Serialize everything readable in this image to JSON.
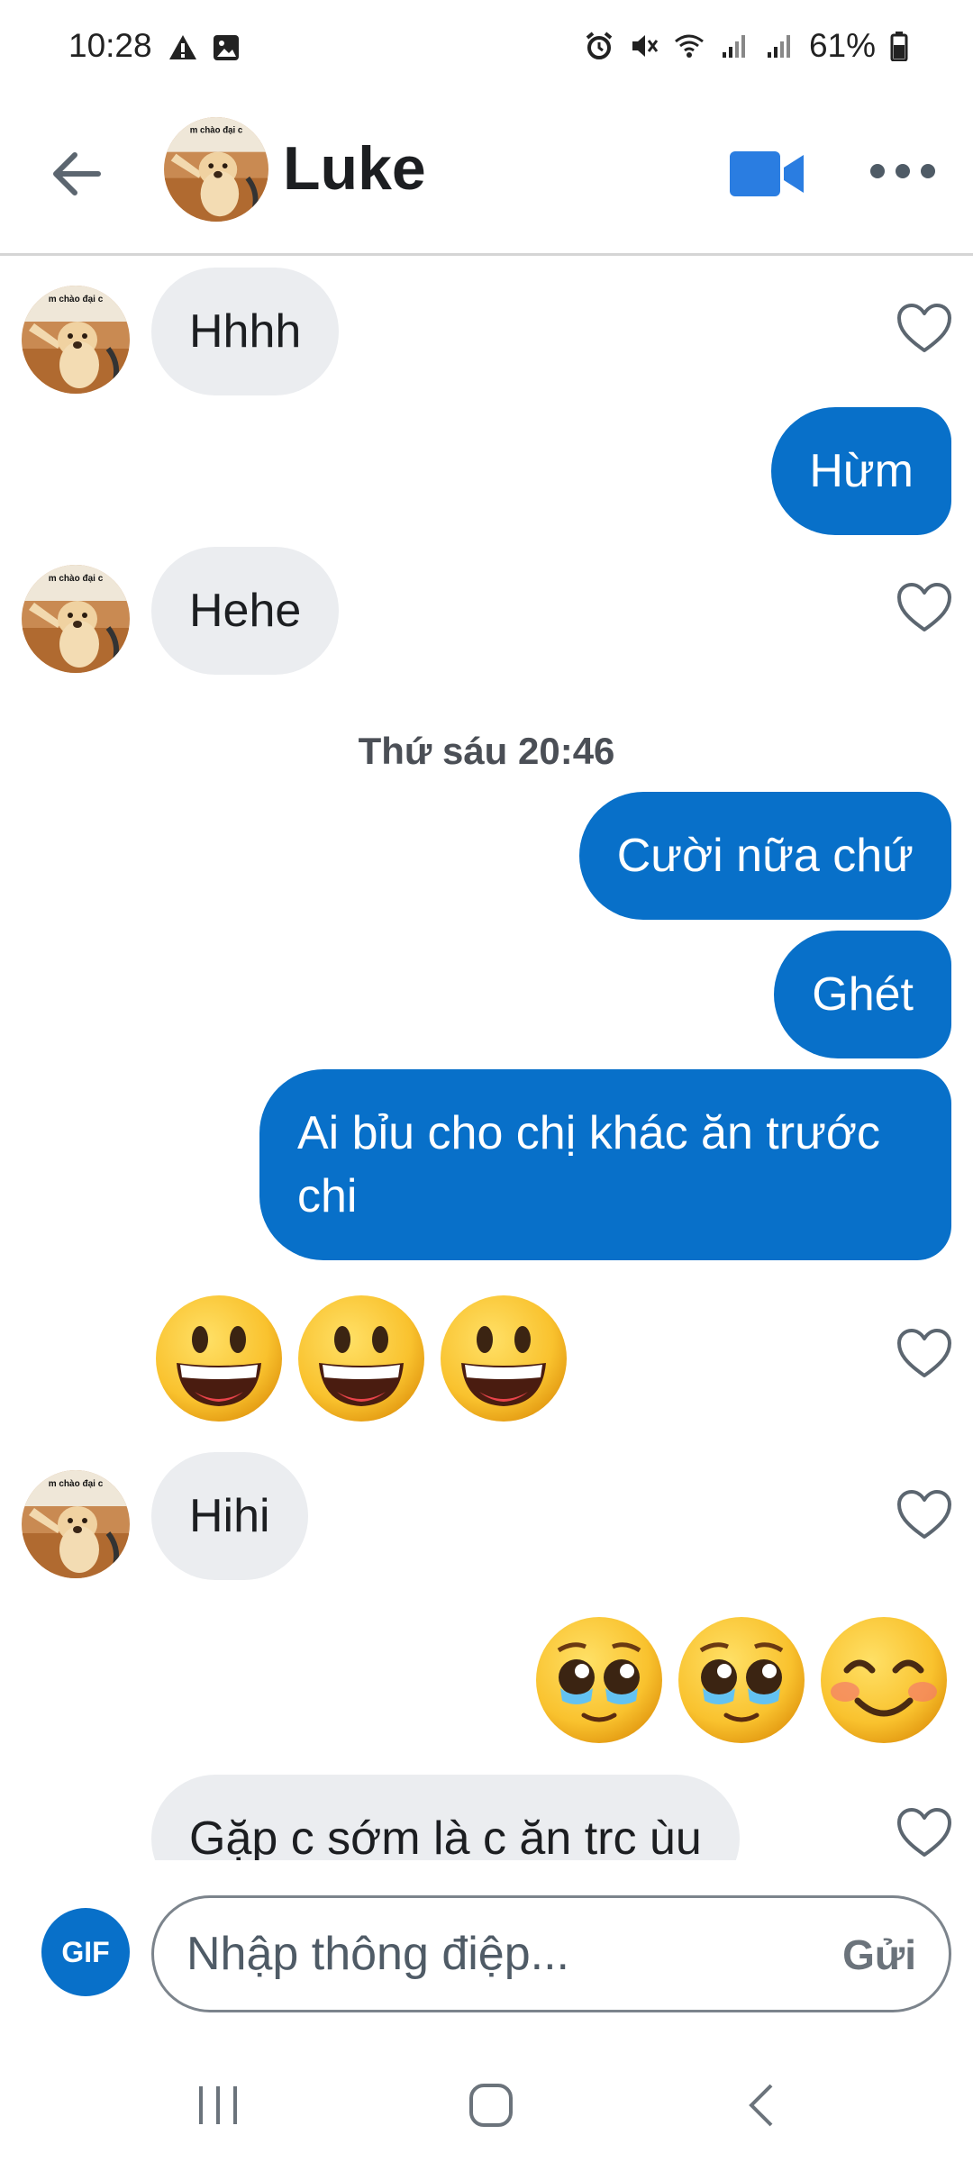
{
  "status_bar": {
    "time": "10:28",
    "battery": "61%",
    "left_icons": [
      "warning-icon",
      "image-icon"
    ],
    "right_icons": [
      "alarm-icon",
      "mute-icon",
      "wifi-icon",
      "signal-icon",
      "signal-icon",
      "battery-icon"
    ]
  },
  "header": {
    "contact_name": "Luke",
    "avatar_caption": "em chào đại ca"
  },
  "messages": [
    {
      "side": "in",
      "text": "Hhhh"
    },
    {
      "side": "out",
      "text": "Hừm"
    },
    {
      "side": "in",
      "text": "Hehe"
    },
    {
      "type": "timestamp",
      "text": "Thứ sáu 20:46"
    },
    {
      "side": "out",
      "text": "Cười nữa chứ"
    },
    {
      "side": "out",
      "text": "Ghét"
    },
    {
      "side": "out",
      "text": "Ai bỉu cho chị khác ăn trước chi"
    },
    {
      "side": "in",
      "emoji": [
        "grinning-face",
        "grinning-face",
        "grinning-face"
      ]
    },
    {
      "side": "in",
      "text": "Hihi"
    },
    {
      "side": "out",
      "emoji": [
        "pleading-face",
        "pleading-face",
        "smiling-face"
      ]
    },
    {
      "side": "in",
      "text": "Gặp c sớm là c ăn trc ùu"
    }
  ],
  "composer": {
    "gif_label": "GIF",
    "placeholder": "Nhập thông điệp...",
    "send_label": "Gửi"
  },
  "colors": {
    "accent": "#0870c9",
    "incoming_bubble": "#ebedf0",
    "outgoing_bubble": "#0870c9"
  }
}
